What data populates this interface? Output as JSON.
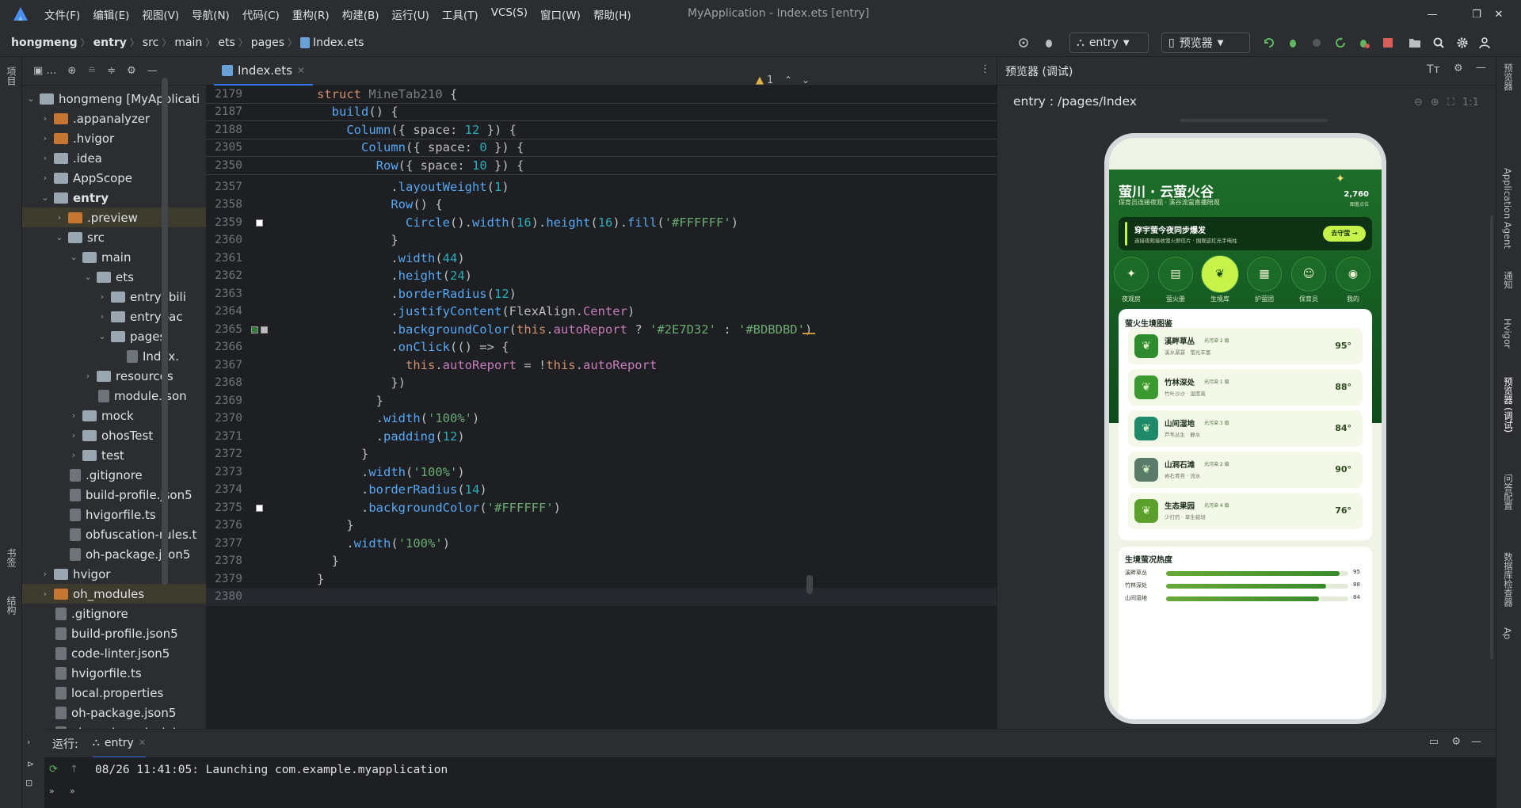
{
  "window": {
    "title": "MyApplication - Index.ets [entry]",
    "menu": [
      "文件(F)",
      "编辑(E)",
      "视图(V)",
      "导航(N)",
      "代码(C)",
      "重构(R)",
      "构建(B)",
      "运行(U)",
      "工具(T)",
      "VCS(S)",
      "窗口(W)",
      "帮助(H)"
    ]
  },
  "breadcrumb": [
    "hongmeng",
    "entry",
    "src",
    "main",
    "ets",
    "pages",
    "Index.ets"
  ],
  "toolbar": {
    "module_combo": "entry",
    "device_combo": "预览器"
  },
  "left_strip": {
    "project_label": "项目",
    "bookmarks_label": "书签",
    "structure_label": "结构"
  },
  "project_tree": [
    {
      "indent": 0,
      "arrow": "⌄",
      "icon": "folder",
      "label": "hongmeng [MyApplicati",
      "sel": false
    },
    {
      "indent": 1,
      "arrow": "›",
      "icon": "orange",
      "label": ".appanalyzer"
    },
    {
      "indent": 1,
      "arrow": "›",
      "icon": "orange",
      "label": ".hvigor"
    },
    {
      "indent": 1,
      "arrow": "›",
      "icon": "folder",
      "label": ".idea"
    },
    {
      "indent": 1,
      "arrow": "›",
      "icon": "folder",
      "label": "AppScope"
    },
    {
      "indent": 1,
      "arrow": "⌄",
      "icon": "folder",
      "label": "entry",
      "bold": true
    },
    {
      "indent": 2,
      "arrow": "›",
      "icon": "orange",
      "label": ".preview",
      "hl": true
    },
    {
      "indent": 2,
      "arrow": "⌄",
      "icon": "folder",
      "label": "src"
    },
    {
      "indent": 3,
      "arrow": "⌄",
      "icon": "folder",
      "label": "main"
    },
    {
      "indent": 4,
      "arrow": "⌄",
      "icon": "folder",
      "label": "ets"
    },
    {
      "indent": 5,
      "arrow": "›",
      "icon": "folder",
      "label": "entryabili"
    },
    {
      "indent": 5,
      "arrow": "›",
      "icon": "folder",
      "label": "entrybac"
    },
    {
      "indent": 5,
      "arrow": "⌄",
      "icon": "folder",
      "label": "pages"
    },
    {
      "indent": 6,
      "arrow": "",
      "icon": "file",
      "label": "Index."
    },
    {
      "indent": 4,
      "arrow": "›",
      "icon": "folder",
      "label": "resources"
    },
    {
      "indent": 4,
      "arrow": "",
      "icon": "file",
      "label": "module.json"
    },
    {
      "indent": 3,
      "arrow": "›",
      "icon": "folder",
      "label": "mock"
    },
    {
      "indent": 3,
      "arrow": "›",
      "icon": "folder",
      "label": "ohosTest"
    },
    {
      "indent": 3,
      "arrow": "›",
      "icon": "folder",
      "label": "test"
    },
    {
      "indent": 2,
      "arrow": "",
      "icon": "file",
      "label": ".gitignore"
    },
    {
      "indent": 2,
      "arrow": "",
      "icon": "file",
      "label": "build-profile.json5"
    },
    {
      "indent": 2,
      "arrow": "",
      "icon": "file",
      "label": "hvigorfile.ts"
    },
    {
      "indent": 2,
      "arrow": "",
      "icon": "file",
      "label": "obfuscation-rules.t"
    },
    {
      "indent": 2,
      "arrow": "",
      "icon": "file",
      "label": "oh-package.json5"
    },
    {
      "indent": 1,
      "arrow": "›",
      "icon": "folder",
      "label": "hvigor"
    },
    {
      "indent": 1,
      "arrow": "›",
      "icon": "orange",
      "label": "oh_modules",
      "hl": true
    },
    {
      "indent": 1,
      "arrow": "",
      "icon": "file",
      "label": ".gitignore"
    },
    {
      "indent": 1,
      "arrow": "",
      "icon": "file",
      "label": "build-profile.json5"
    },
    {
      "indent": 1,
      "arrow": "",
      "icon": "file",
      "label": "code-linter.json5"
    },
    {
      "indent": 1,
      "arrow": "",
      "icon": "file",
      "label": "hvigorfile.ts"
    },
    {
      "indent": 1,
      "arrow": "",
      "icon": "file",
      "label": "local.properties"
    },
    {
      "indent": 1,
      "arrow": "",
      "icon": "file",
      "label": "oh-package.json5"
    },
    {
      "indent": 1,
      "arrow": "",
      "icon": "file",
      "label": "oh-package-lock.json"
    }
  ],
  "editor": {
    "tab_label": "Index.ets",
    "warning_count": "1",
    "sticky_lines": [
      {
        "ln": "2179",
        "html": "<span class='kw'>struct</span> <span class='dim'>MineTab210</span> {"
      },
      {
        "ln": "2187",
        "html": "  <span class='fn'>build</span>() {"
      },
      {
        "ln": "2188",
        "html": "    <span class='fn'>Column</span>({ space: <span class='nm'>12</span> }) {"
      },
      {
        "ln": "2305",
        "html": "      <span class='fn'>Column</span>({ space: <span class='nm'>0</span> }) {"
      },
      {
        "ln": "2350",
        "html": "        <span class='fn'>Row</span>({ space: <span class='nm'>10</span> }) {"
      }
    ],
    "lines": [
      {
        "ln": "2357",
        "html": "          .<span class='fn'>layoutWeight</span>(<span class='nm'>1</span>)"
      },
      {
        "ln": "2358",
        "html": "          <span class='fn'>Row</span>() {"
      },
      {
        "ln": "2359",
        "html": "            <span class='fn'>Circle</span>().<span class='fn'>width</span>(<span class='nm'>16</span>).<span class='fn'>height</span>(<span class='nm'>16</span>).<span class='fn'>fill</span>(<span class='st'>'#FFFFFF'</span>)"
      },
      {
        "ln": "2360",
        "html": "          }"
      },
      {
        "ln": "2361",
        "html": "          .<span class='fn'>width</span>(<span class='nm'>44</span>)"
      },
      {
        "ln": "2362",
        "html": "          .<span class='fn'>height</span>(<span class='nm'>24</span>)"
      },
      {
        "ln": "2363",
        "html": "          .<span class='fn'>borderRadius</span>(<span class='nm'>12</span>)"
      },
      {
        "ln": "2364",
        "html": "          .<span class='fn'>justifyContent</span>(FlexAlign.<span class='pr'>Center</span>)"
      },
      {
        "ln": "2365",
        "html": "          .<span class='fn'>backgroundColor</span>(<span class='th'>this</span>.<span class='pr'>autoReport</span> ? <span class='st'>'#2E7D32'</span> : <span class='st'>'#BDBDBD'</span>)"
      },
      {
        "ln": "2366",
        "html": "          .<span class='fn'>onClick</span>(() => {"
      },
      {
        "ln": "2367",
        "html": "            <span class='th'>this</span>.<span class='pr'>autoReport</span> = !<span class='th'>this</span>.<span class='pr'>autoReport</span>"
      },
      {
        "ln": "2368",
        "html": "          })"
      },
      {
        "ln": "2369",
        "html": "        }"
      },
      {
        "ln": "2370",
        "html": "        .<span class='fn'>width</span>(<span class='st'>'100%'</span>)"
      },
      {
        "ln": "2371",
        "html": "        .<span class='fn'>padding</span>(<span class='nm'>12</span>)"
      },
      {
        "ln": "2372",
        "html": "      }"
      },
      {
        "ln": "2373",
        "html": "      .<span class='fn'>width</span>(<span class='st'>'100%'</span>)"
      },
      {
        "ln": "2374",
        "html": "      .<span class='fn'>borderRadius</span>(<span class='nm'>14</span>)"
      },
      {
        "ln": "2375",
        "html": "      .<span class='fn'>backgroundColor</span>(<span class='st'>'#FFFFFF'</span>)"
      },
      {
        "ln": "2376",
        "html": "    }"
      },
      {
        "ln": "2377",
        "html": "    .<span class='fn'>width</span>(<span class='st'>'100%'</span>)"
      },
      {
        "ln": "2378",
        "html": "  }"
      },
      {
        "ln": "2379",
        "html": "}"
      },
      {
        "ln": "2380",
        "html": ""
      }
    ]
  },
  "preview": {
    "panel_title": "预览器 (调试)",
    "route": "entry : /pages/Index",
    "app": {
      "title": "萤川 · 云萤火谷",
      "subtitle": "保育员连接夜观 · 溪谷流萤直播陪观",
      "count": "2,760",
      "count_label": "图鉴点位",
      "banner_title": "穿宇萤今夜同步爆发",
      "banner_sub": "连接夜观接收萤火即信片 · 围观这红光手电柱",
      "banner_button": "去守萤 →",
      "nav": [
        "夜观房",
        "萤火册",
        "生境库",
        "护萤团",
        "保育员",
        "我的"
      ],
      "section1": "萤火生境图鉴",
      "cards": [
        {
          "title": "溪畔草丛",
          "tag": "光污染 2 级",
          "sub": "溪水潺潺 · 萤光丰富",
          "score": "95°"
        },
        {
          "title": "竹林深处",
          "tag": "光污染 1 级",
          "sub": "竹叶沙沙 · 湿度高",
          "score": "88°"
        },
        {
          "title": "山间湿地",
          "tag": "光污染 3 级",
          "sub": "芦苇丛生 · 静水",
          "score": "84°"
        },
        {
          "title": "山涧石滩",
          "tag": "光污染 2 级",
          "sub": "岩石青苔 · 流水",
          "score": "90°"
        },
        {
          "title": "生态果园",
          "tag": "光污染 4 级",
          "sub": "少打药 · 草生栽培",
          "score": "76°"
        }
      ],
      "section2": "生境萤况热度",
      "heat": [
        {
          "label": "溪畔草丛",
          "value": 95
        },
        {
          "label": "竹林深处",
          "value": 88
        },
        {
          "label": "山间湿地",
          "value": 84
        }
      ]
    }
  },
  "right_strip": [
    "预览器",
    "Application Agent",
    "通知",
    "Hvigor",
    "预览器 (调试)",
    "问答配置",
    "数据库检查器",
    "Ap"
  ],
  "run": {
    "label": "运行:",
    "config": "entry",
    "log": "08/26 11:41:05: Launching com.example.myapplication"
  },
  "colors": {
    "accent": "#3574f0",
    "phone_green": "#1e6d2a",
    "lime": "#c6f24a"
  }
}
